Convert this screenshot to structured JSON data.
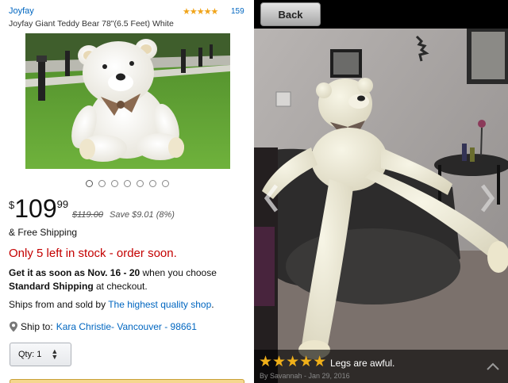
{
  "listing": {
    "brand": "Joyfay",
    "stars": "★★★★★",
    "review_count": "159",
    "title": "Joyfay Giant Teddy Bear 78\"(6.5 Feet) White",
    "image_count": 7,
    "current_image": 1
  },
  "pricing": {
    "currency": "$",
    "whole": "109",
    "fraction": "99",
    "list_price": "$119.00",
    "savings": "Save $9.01 (8%)",
    "free_shipping": "& Free Shipping"
  },
  "stock": {
    "message": "Only 5 left in stock - order soon."
  },
  "delivery": {
    "prefix": "Get it as soon as Nov. 16 - 20",
    "middle": " when you choose ",
    "method": "Standard Shipping",
    "suffix": " at checkout."
  },
  "fulfillment": {
    "prefix": "Ships from and sold by ",
    "seller": "The highest quality shop",
    "suffix": "."
  },
  "ship_to": {
    "label": "Ship to:",
    "address": "Kara Christie- Vancouver - 98661"
  },
  "quantity": {
    "label": "Qty:",
    "value": "1"
  },
  "review_viewer": {
    "back_label": "Back",
    "rating_stars": "★★★★★",
    "review_text": "Legs are awful.",
    "byline": "By Savannah - Jan 29, 2016"
  },
  "colors": {
    "link": "#0066c0",
    "stock_red": "#c40000",
    "star_gold": "#f0a41a"
  }
}
